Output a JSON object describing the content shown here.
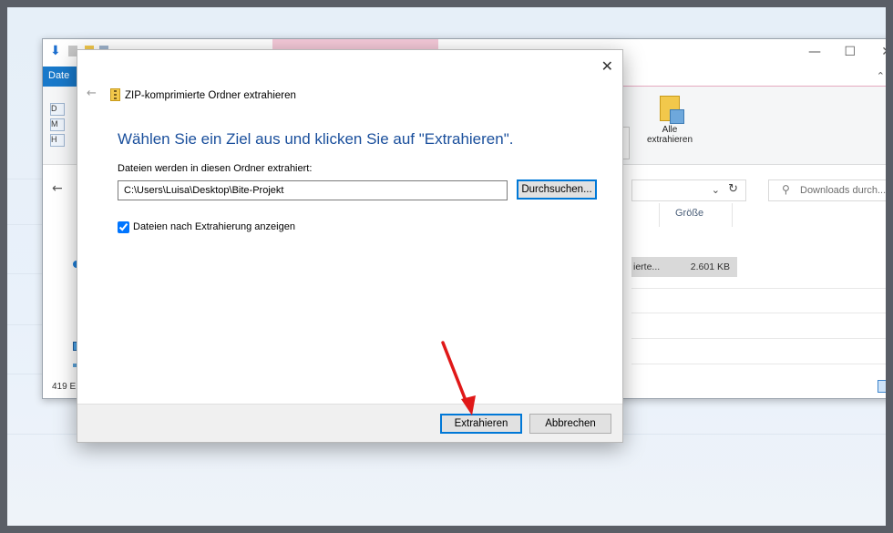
{
  "explorer": {
    "file_tab_label": "Date",
    "extract_all_label_1": "Alle",
    "extract_all_label_2": "extrahieren",
    "search_placeholder": "Downloads durch...",
    "column_size_label": "Größe",
    "file_type_text": "ierte...",
    "file_size_text": "2.601 KB",
    "status_text": "419 E",
    "sidebar_letters": [
      "D",
      "M",
      "H"
    ],
    "minimize_glyph": "—",
    "maximize_glyph": "☐",
    "close_glyph": "✕"
  },
  "dialog": {
    "title": "ZIP-komprimierte Ordner extrahieren",
    "heading": "Wählen Sie ein Ziel aus und klicken Sie auf \"Extrahieren\".",
    "destination_label": "Dateien werden in diesen Ordner extrahiert:",
    "destination_path": "C:\\Users\\Luisa\\Desktop\\Bite-Projekt",
    "browse_button": "Durchsuchen...",
    "show_files_label": "Dateien nach Extrahierung anzeigen",
    "show_files_checked": true,
    "extract_button": "Extrahieren",
    "cancel_button": "Abbrechen",
    "close_glyph": "✕",
    "back_glyph": "←"
  },
  "colors": {
    "accent": "#0078d7",
    "heading": "#1a4f9c",
    "annotation_arrow": "#e01818"
  }
}
